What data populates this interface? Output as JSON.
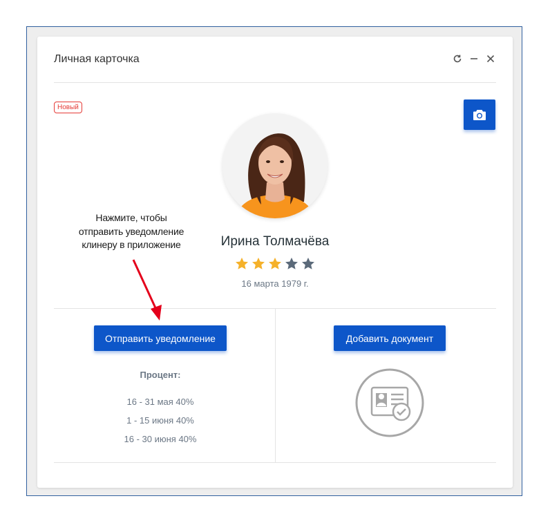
{
  "window": {
    "title": "Личная карточка",
    "controls": [
      "refresh-icon",
      "minimize-icon",
      "close-icon"
    ]
  },
  "badge": {
    "label": "Новый",
    "color": "#e53935"
  },
  "camera_button": {
    "icon": "camera-icon"
  },
  "profile": {
    "name": "Ирина Толмачёва",
    "rating": 3,
    "rating_max": 5,
    "birthdate": "16 марта 1979 г."
  },
  "hint": {
    "lines": [
      "Нажмите, чтобы",
      "отправить уведомление",
      "клинеру в приложение"
    ],
    "arrow_color": "#e4001b"
  },
  "actions": {
    "send_notification": "Отправить уведомление",
    "add_document": "Добавить документ"
  },
  "percent": {
    "label": "Процент:",
    "items": [
      "16 - 31 мая 40%",
      "1 - 15 июня 40%",
      "16 - 30 июня 40%"
    ]
  },
  "document_icon": {
    "icon": "id-card-check-icon"
  },
  "colors": {
    "accent": "#0d56c9",
    "star_filled": "#f5b12a",
    "star_empty": "#5b6a7a"
  }
}
